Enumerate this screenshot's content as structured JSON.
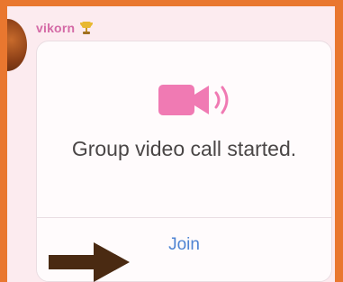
{
  "message": {
    "sender": "vikorn",
    "sender_badge_icon": "trophy-icon",
    "call_icon": "video-camera-icon",
    "text": "Group video call started.",
    "join_label": "Join"
  },
  "annotation": {
    "icon": "arrow-right-icon",
    "color": "#4a2a12"
  },
  "colors": {
    "frame": "#e9772f",
    "background": "#fcebef",
    "sender_name": "#d46aa6",
    "video_icon": "#f07ab3",
    "join_link": "#4f84d3"
  }
}
